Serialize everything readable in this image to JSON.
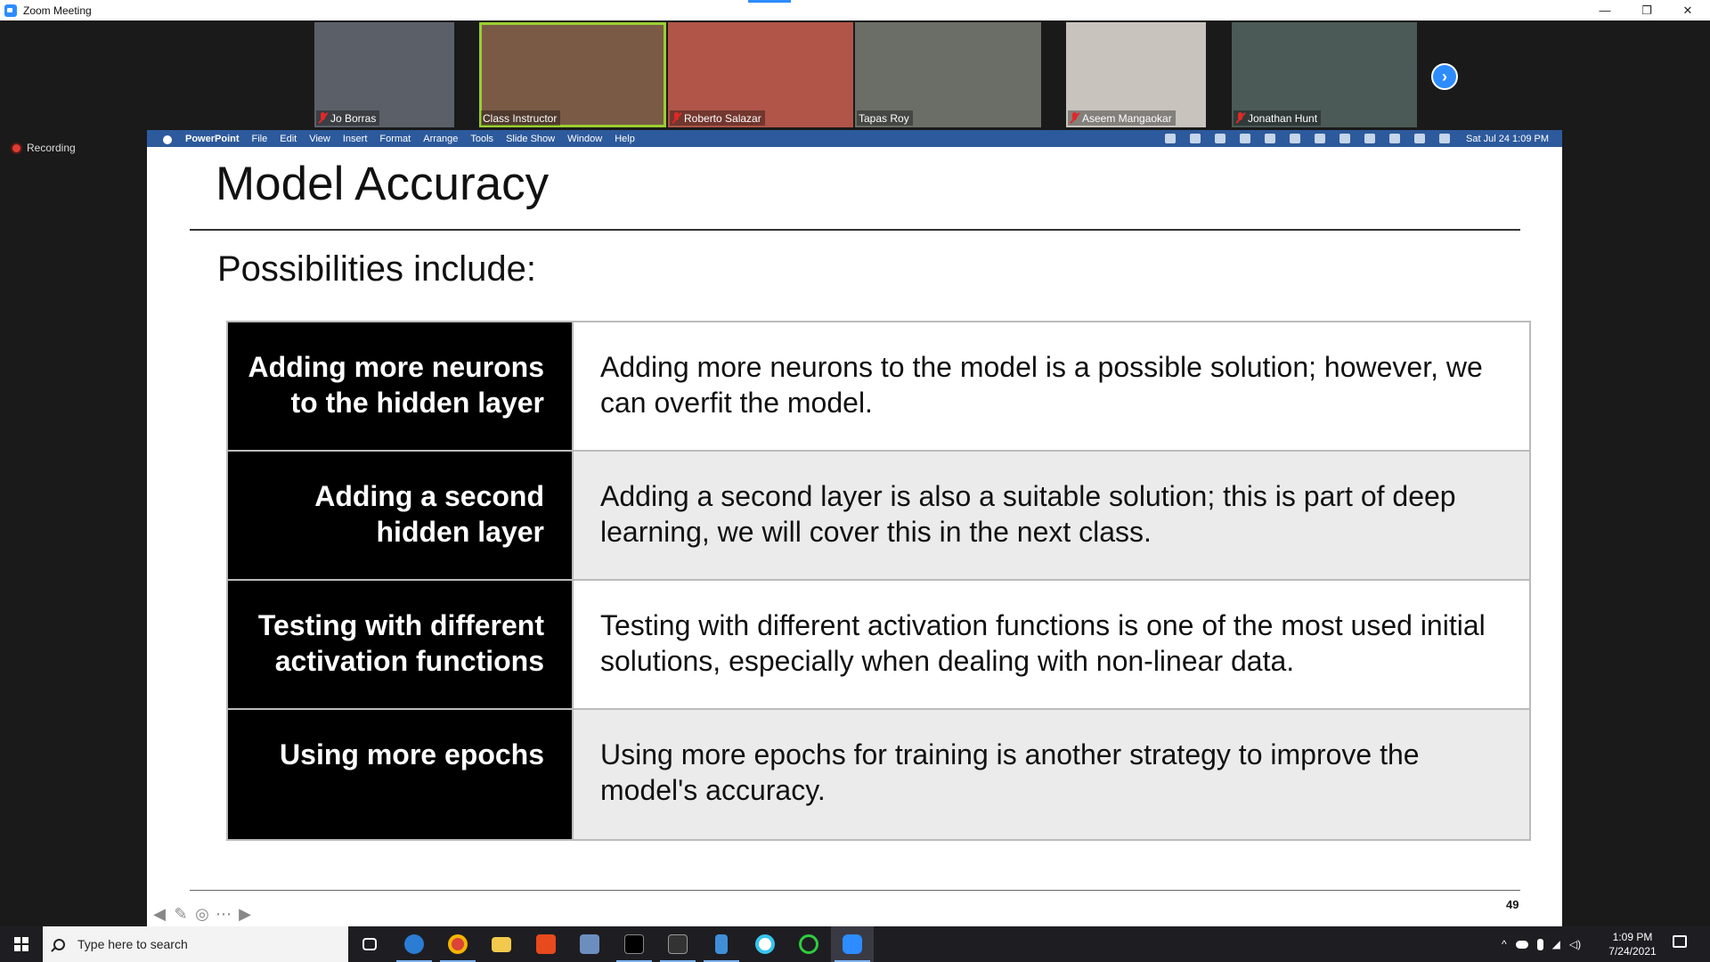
{
  "window": {
    "title": "Zoom Meeting",
    "controls": {
      "minimize": "—",
      "restore": "❐",
      "close": "✕"
    }
  },
  "participants": [
    {
      "name": "Jo Borras",
      "muted": true,
      "bg": "#5b6068"
    },
    {
      "name": "Class Instructor",
      "muted": false,
      "bg": "#7a5a45",
      "active": true
    },
    {
      "name": "Roberto Salazar",
      "muted": true,
      "bg": "#b05548"
    },
    {
      "name": "Tapas Roy",
      "muted": false,
      "bg": "#6b6e66"
    },
    {
      "name": "Aseem Mangaokar",
      "muted": true,
      "bg": "#c9c3bd"
    },
    {
      "name": "Jonathan Hunt",
      "muted": true,
      "bg": "#4b5a56"
    }
  ],
  "recording": {
    "label": "Recording"
  },
  "mac_menubar": {
    "app": "PowerPoint",
    "menus": [
      "File",
      "Edit",
      "View",
      "Insert",
      "Format",
      "Arrange",
      "Tools",
      "Slide Show",
      "Window",
      "Help"
    ],
    "clock": "Sat Jul 24  1:09 PM"
  },
  "slide": {
    "title": "Model Accuracy",
    "subheading": "Possibilities include:",
    "rows": [
      {
        "option": "Adding more neurons to the hidden layer",
        "description": "Adding more neurons to the model is a possible solution; however, we can overfit the model."
      },
      {
        "option": "Adding a second hidden layer",
        "description": "Adding a second layer is also a suitable solution; this is part of deep learning, we will cover this in the next class."
      },
      {
        "option": "Testing with different activation functions",
        "description": "Testing with different activation functions is one of the most used initial solutions, especially when dealing with non-linear data."
      },
      {
        "option": "Using more epochs",
        "description": "Using more epochs for training is another strategy to improve the model's accuracy."
      }
    ],
    "number": "49"
  },
  "taskbar": {
    "search_placeholder": "Type here to search",
    "time": "1:09 PM",
    "date": "7/24/2021"
  }
}
